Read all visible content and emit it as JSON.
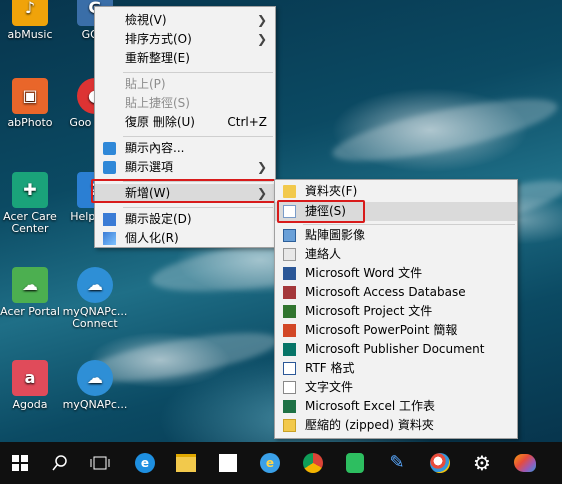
{
  "desktop_icons": [
    {
      "label": "abMusic",
      "color": "#f0a30a"
    },
    {
      "label": "GOM",
      "color": "#3a6ea8"
    },
    {
      "label": "abPhoto",
      "color": "#e9662a"
    },
    {
      "label": "Goo Chro",
      "color": "#d33"
    },
    {
      "label": "Acer Care Center",
      "color": "#1aa37a"
    },
    {
      "label": "Help Sup",
      "color": "#2b7fd3"
    },
    {
      "label": "Acer Portal",
      "color": "#4caf50"
    },
    {
      "label": "myQNAPc... Connect",
      "color": "#2e8fd6"
    },
    {
      "label": "Agoda",
      "color": "#e04b5a"
    },
    {
      "label": "myQNAPc...",
      "color": "#2e8fd6"
    }
  ],
  "context_menu": {
    "items": [
      {
        "label": "檢視(V)"
      },
      {
        "label": "排序方式(O)"
      },
      {
        "label": "重新整理(E)"
      },
      {
        "label": "貼上(P)"
      },
      {
        "label": "貼上捷徑(S)"
      },
      {
        "label": "復原 刪除(U)",
        "shortcut": "Ctrl+Z"
      },
      {
        "label": "顯示內容..."
      },
      {
        "label": "顯示選項"
      },
      {
        "label": "新增(W)"
      },
      {
        "label": "顯示設定(D)"
      },
      {
        "label": "個人化(R)"
      }
    ]
  },
  "submenu": {
    "items": [
      {
        "label": "資料夾(F)"
      },
      {
        "label": "捷徑(S)"
      },
      {
        "label": "點陣圖影像"
      },
      {
        "label": "連絡人"
      },
      {
        "label": "Microsoft Word 文件"
      },
      {
        "label": "Microsoft Access Database"
      },
      {
        "label": "Microsoft Project 文件"
      },
      {
        "label": "Microsoft PowerPoint 簡報"
      },
      {
        "label": "Microsoft Publisher Document"
      },
      {
        "label": "RTF 格式"
      },
      {
        "label": "文字文件"
      },
      {
        "label": "Microsoft Excel 工作表"
      },
      {
        "label": "壓縮的 (zipped) 資料夾"
      }
    ]
  },
  "colors": {
    "highlight_box": "#d81b1b",
    "taskbar": "#101010"
  },
  "taskbar_icons": [
    "start-icon",
    "search-icon",
    "task-view-icon",
    "edge-icon",
    "file-explorer-icon",
    "store-icon",
    "ie-icon",
    "chrome-icon",
    "evernote-icon",
    "app-icon",
    "paint-icon",
    "settings-icon",
    "palette-icon"
  ]
}
